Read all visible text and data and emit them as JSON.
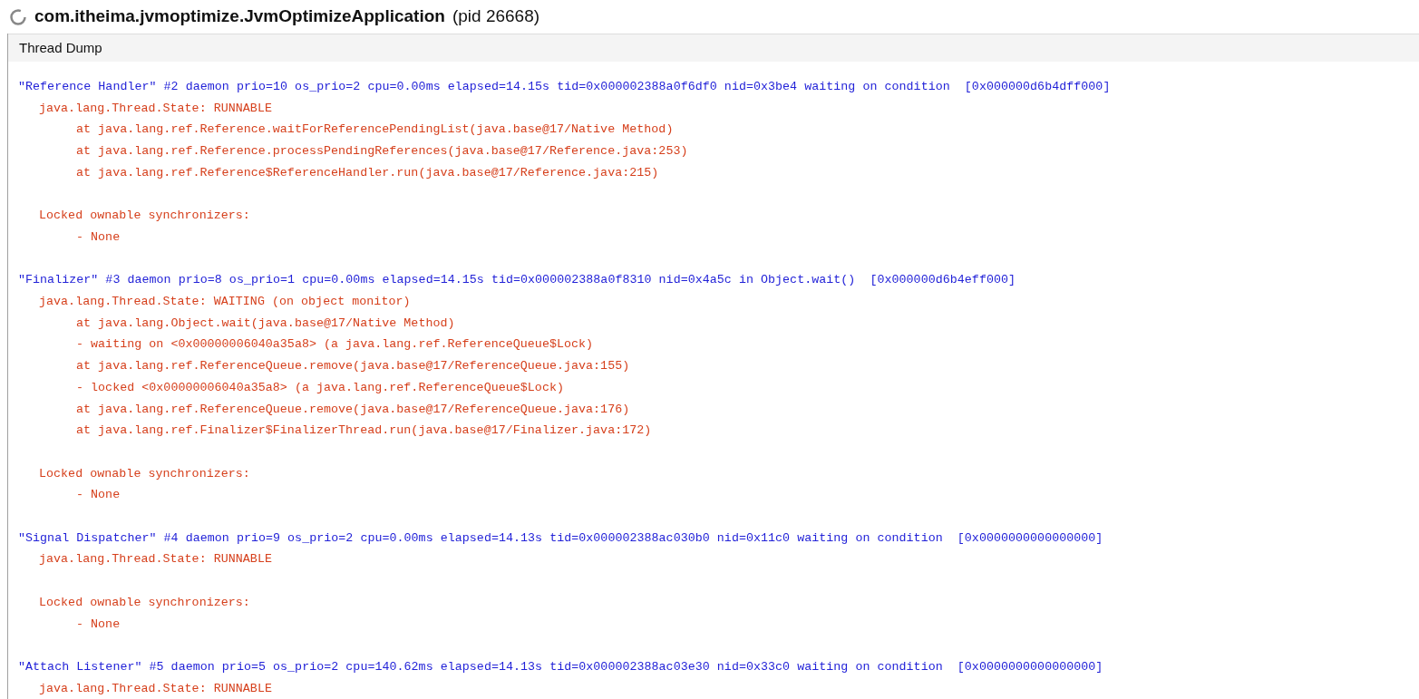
{
  "window": {
    "title": "com.itheima.jvmoptimize.JvmOptimizeApplication",
    "pid": "(pid 26668)"
  },
  "tabs": [
    {
      "label": "Thread Dump"
    }
  ],
  "threads": [
    {
      "header": "\"Reference Handler\" #2 daemon prio=10 os_prio=2 cpu=0.00ms elapsed=14.15s tid=0x000002388a0f6df0 nid=0x3be4 waiting on condition  [0x000000d6b4dff000]",
      "state": "java.lang.Thread.State: RUNNABLE",
      "frames": [
        "at java.lang.ref.Reference.waitForReferencePendingList(java.base@17/Native Method)",
        "at java.lang.ref.Reference.processPendingReferences(java.base@17/Reference.java:253)",
        "at java.lang.ref.Reference$ReferenceHandler.run(java.base@17/Reference.java:215)"
      ],
      "locks_label": "Locked ownable synchronizers:",
      "locks": [
        "- None"
      ]
    },
    {
      "header": "\"Finalizer\" #3 daemon prio=8 os_prio=1 cpu=0.00ms elapsed=14.15s tid=0x000002388a0f8310 nid=0x4a5c in Object.wait()  [0x000000d6b4eff000]",
      "state": "java.lang.Thread.State: WAITING (on object monitor)",
      "frames": [
        "at java.lang.Object.wait(java.base@17/Native Method)",
        "- waiting on <0x00000006040a35a8> (a java.lang.ref.ReferenceQueue$Lock)",
        "at java.lang.ref.ReferenceQueue.remove(java.base@17/ReferenceQueue.java:155)",
        "- locked <0x00000006040a35a8> (a java.lang.ref.ReferenceQueue$Lock)",
        "at java.lang.ref.ReferenceQueue.remove(java.base@17/ReferenceQueue.java:176)",
        "at java.lang.ref.Finalizer$FinalizerThread.run(java.base@17/Finalizer.java:172)"
      ],
      "locks_label": "Locked ownable synchronizers:",
      "locks": [
        "- None"
      ]
    },
    {
      "header": "\"Signal Dispatcher\" #4 daemon prio=9 os_prio=2 cpu=0.00ms elapsed=14.13s tid=0x000002388ac030b0 nid=0x11c0 waiting on condition  [0x0000000000000000]",
      "state": "java.lang.Thread.State: RUNNABLE",
      "locks_label": "Locked ownable synchronizers:",
      "locks": [
        "- None"
      ]
    },
    {
      "header": "\"Attach Listener\" #5 daemon prio=5 os_prio=2 cpu=140.62ms elapsed=14.13s tid=0x000002388ac03e30 nid=0x33c0 waiting on condition  [0x0000000000000000]",
      "state": "java.lang.Thread.State: RUNNABLE"
    }
  ]
}
